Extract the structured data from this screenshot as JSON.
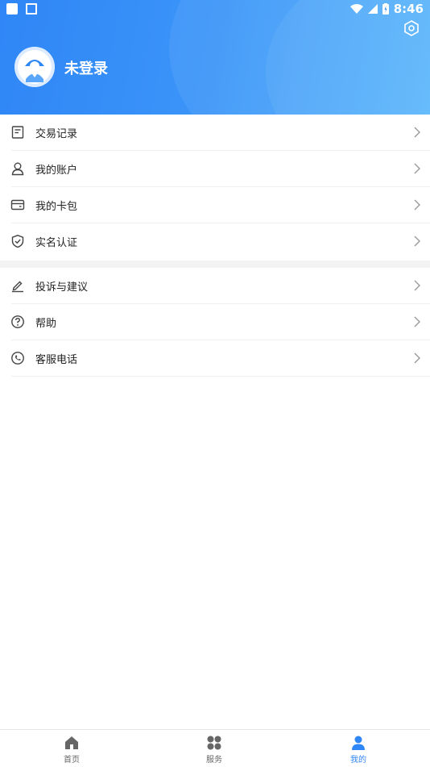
{
  "status_bar": {
    "time": "8:46"
  },
  "profile": {
    "login_status": "未登录"
  },
  "menu_group_1": [
    {
      "label": "交易记录",
      "icon": "receipt-icon"
    },
    {
      "label": "我的账户",
      "icon": "user-icon"
    },
    {
      "label": "我的卡包",
      "icon": "card-icon"
    },
    {
      "label": "实名认证",
      "icon": "shield-icon"
    }
  ],
  "menu_group_2": [
    {
      "label": "投诉与建议",
      "icon": "edit-icon"
    },
    {
      "label": "帮助",
      "icon": "help-icon"
    },
    {
      "label": "客服电话",
      "icon": "phone-icon"
    }
  ],
  "tab_bar": {
    "tabs": [
      {
        "label": "首页",
        "icon": "home-icon"
      },
      {
        "label": "服务",
        "icon": "grid-icon"
      },
      {
        "label": "我的",
        "icon": "person-icon",
        "active": true
      }
    ]
  },
  "colors": {
    "accent": "#2f86f6",
    "separator": "#f3f3f3"
  }
}
